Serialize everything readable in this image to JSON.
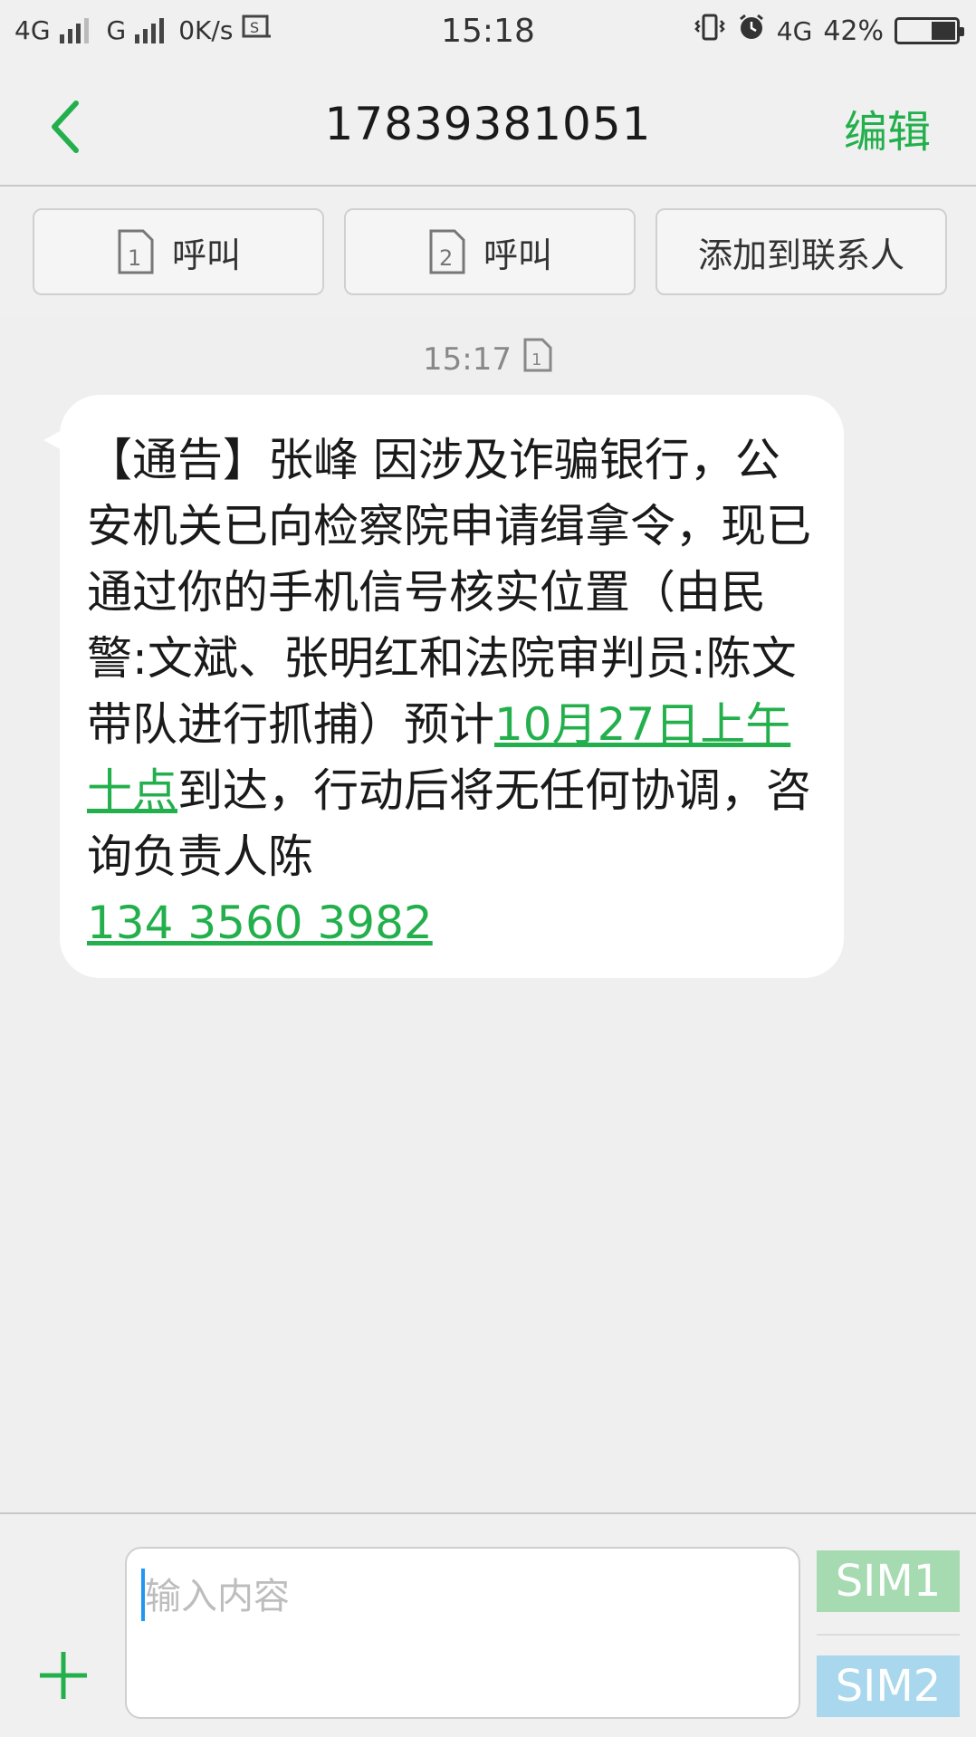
{
  "status_bar": {
    "network1": "4G",
    "network2": "G",
    "speed": "0K/s",
    "time": "15:18",
    "network3": "4G",
    "battery": "42%",
    "battery_level": 0.42
  },
  "header": {
    "title": "17839381051",
    "edit_label": "编辑",
    "accent_color": "#23b04c"
  },
  "actions": {
    "call_sim1": {
      "sim": "1",
      "label": "呼叫"
    },
    "call_sim2": {
      "sim": "2",
      "label": "呼叫"
    },
    "add_contact": "添加到联系人"
  },
  "conversation": {
    "timestamp": "15:17",
    "timestamp_sim": "1",
    "message": {
      "part1": "【通告】张峰 因涉及诈骗银行，公安机关已向检察院申请缉拿令，现已通过你的手机信号核实位置（由民警:文斌、张明红和法院审判员:陈文带队进行抓捕）预计",
      "link_time": "10月27日上午十点",
      "part2": "到达，行动后将无任何协调，咨询负责人陈",
      "link_phone": "134 3560 3982"
    }
  },
  "input_bar": {
    "placeholder": "输入内容",
    "sim1_label": "SIM1",
    "sim2_label": "SIM2"
  }
}
